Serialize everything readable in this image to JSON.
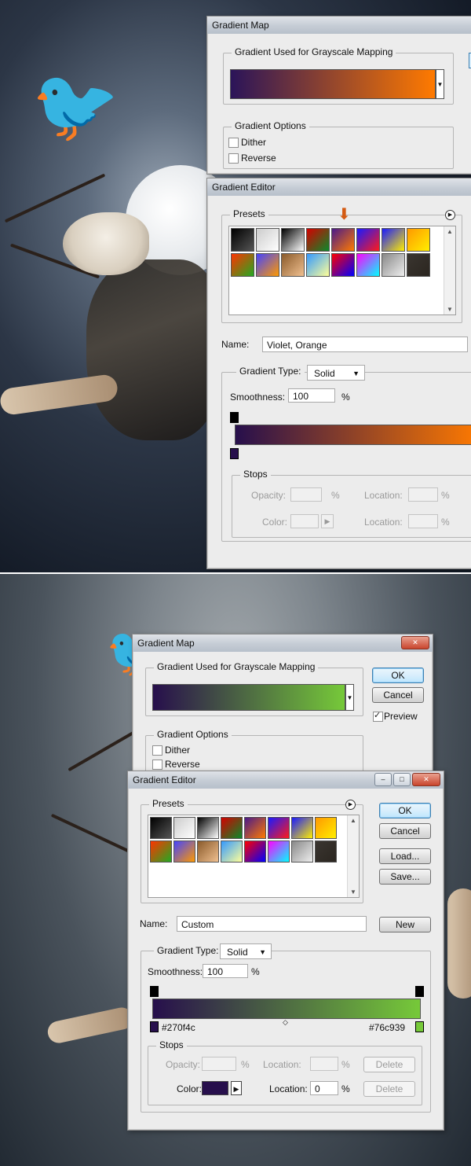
{
  "top": {
    "gm": {
      "title": "Gradient Map",
      "gradient_group": "Gradient Used for Grayscale Mapping",
      "options_group": "Gradient Options",
      "dither": "Dither",
      "reverse": "Reverse",
      "gradient": [
        "#2b1459",
        "#ff7a00"
      ]
    },
    "ge": {
      "title": "Gradient Editor",
      "presets": "Presets",
      "name_label": "Name:",
      "name_value": "Violet, Orange",
      "type_label": "Gradient Type:",
      "type_value": "Solid",
      "smooth_label": "Smoothness:",
      "smooth_value": "100",
      "percent": "%",
      "stops": "Stops",
      "opacity": "Opacity:",
      "location": "Location:",
      "color": "Color:",
      "gradient": [
        "#270f4c",
        "#ff7a00"
      ]
    }
  },
  "bottom": {
    "gm": {
      "title": "Gradient Map",
      "gradient_group": "Gradient Used for Grayscale Mapping",
      "options_group": "Gradient Options",
      "dither": "Dither",
      "reverse": "Reverse",
      "ok": "OK",
      "cancel": "Cancel",
      "preview": "Preview",
      "gradient": [
        "#270f4c",
        "#76c939"
      ]
    },
    "ge": {
      "title": "Gradient Editor",
      "presets": "Presets",
      "ok": "OK",
      "cancel": "Cancel",
      "load": "Load...",
      "save": "Save...",
      "name_label": "Name:",
      "name_value": "Custom",
      "new": "New",
      "type_label": "Gradient Type:",
      "type_value": "Solid",
      "smooth_label": "Smoothness:",
      "smooth_value": "100",
      "percent": "%",
      "left_color": "#270f4c",
      "right_color": "#76c939",
      "stops": "Stops",
      "opacity": "Opacity:",
      "location": "Location:",
      "color": "Color:",
      "location_value": "0",
      "delete": "Delete",
      "gradient": [
        "#270f4c",
        "#76c939"
      ]
    }
  },
  "presets": [
    [
      "#000000",
      "#555555"
    ],
    [
      "#cccccc",
      "#ffffff"
    ],
    [
      "#000000",
      "#ffffff"
    ],
    [
      "#d40000",
      "#0a8a2a"
    ],
    [
      "#4a1a8a",
      "#ff7a00"
    ],
    [
      "#1a1aff",
      "#ff1a1a"
    ],
    [
      "#1a1aff",
      "#ffee00"
    ],
    [
      "#ff9900",
      "#ffee00"
    ],
    [
      "#ff3300",
      "#22aa22"
    ],
    [
      "#4444ff",
      "#ff9900"
    ],
    [
      "#8a5a2a",
      "#f0c090"
    ],
    [
      "#3399ff",
      "#ffff99"
    ],
    [
      "#ff0000",
      "#0000ff"
    ],
    [
      "#ff00ff",
      "#00ffff"
    ],
    [
      "#888888",
      "#eeeeee"
    ],
    [
      "#3a3530",
      "#2b2620"
    ]
  ]
}
